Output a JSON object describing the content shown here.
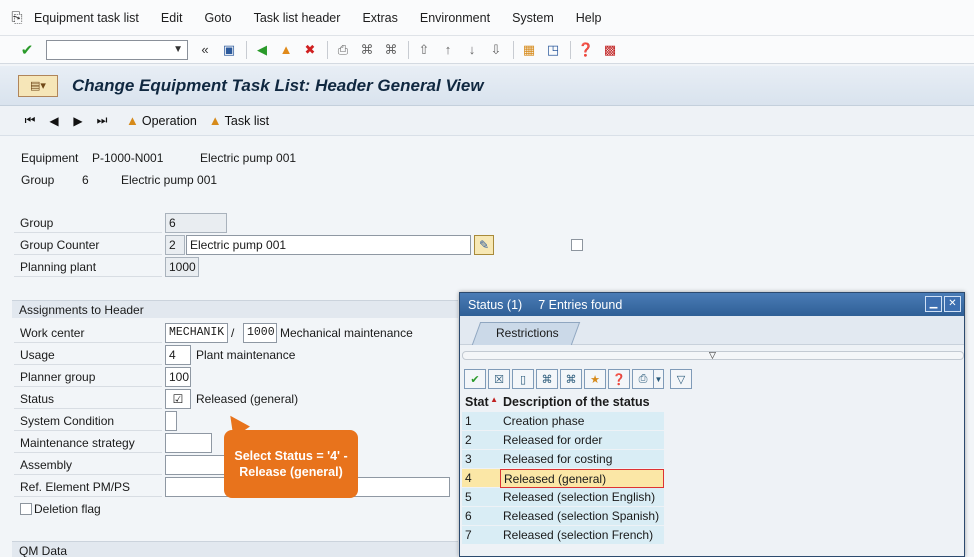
{
  "menu": {
    "items": [
      "Equipment task list",
      "Edit",
      "Goto",
      "Task list header",
      "Extras",
      "Environment",
      "System",
      "Help"
    ]
  },
  "toolbar": {
    "command_value": ""
  },
  "title": {
    "text": "Change Equipment Task List: Header General View"
  },
  "app_toolbar": {
    "operation": "Operation",
    "task_list": "Task list"
  },
  "header_info": {
    "equipment_label": "Equipment",
    "equipment_id": "P-1000-N001",
    "equipment_desc": "Electric pump 001",
    "group_label": "Group",
    "group_id": "6",
    "group_desc": "Electric pump 001"
  },
  "form": {
    "group_label": "Group",
    "group_value": "6",
    "group_counter_label": "Group Counter",
    "group_counter_value": "2",
    "group_counter_desc": "Electric pump 001",
    "planning_plant_label": "Planning plant",
    "planning_plant_value": "1000"
  },
  "assignments": {
    "section_title": "Assignments to Header",
    "work_center_label": "Work center",
    "work_center_value": "MECHANIK",
    "work_center_sep": "/",
    "work_center_plant": "1000",
    "work_center_desc": "Mechanical maintenance",
    "usage_label": "Usage",
    "usage_value": "4",
    "usage_desc": "Plant maintenance",
    "planner_group_label": "Planner group",
    "planner_group_value": "100",
    "status_label": "Status",
    "status_desc": "Released (general)",
    "system_condition_label": "System Condition",
    "maintenance_strategy_label": "Maintenance strategy",
    "assembly_label": "Assembly",
    "ref_element_label": "Ref. Element PM/PS",
    "deletion_flag_label": "Deletion flag"
  },
  "qm_section": {
    "title": "QM Data"
  },
  "callout": {
    "text": "Select Status = '4' - Release (general)"
  },
  "dialog": {
    "title": "Status (1)",
    "entries": "7 Entries found",
    "tab": "Restrictions",
    "col_stat": "Stat",
    "col_desc": "Description of the status",
    "rows": [
      {
        "code": "1",
        "desc": "Creation phase"
      },
      {
        "code": "2",
        "desc": "Released for order"
      },
      {
        "code": "3",
        "desc": "Released for costing"
      },
      {
        "code": "4",
        "desc": "Released (general)"
      },
      {
        "code": "5",
        "desc": "Released (selection English)"
      },
      {
        "code": "6",
        "desc": "Released (selection Spanish)"
      },
      {
        "code": "7",
        "desc": "Released (selection French)"
      }
    ]
  }
}
